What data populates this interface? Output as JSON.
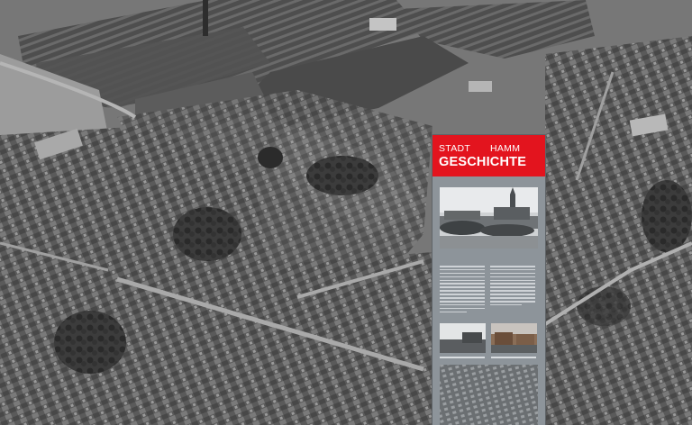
{
  "scene": {
    "description_tag": "aerial-photo"
  },
  "board": {
    "header_left": "STADT",
    "header_right": "HAMM",
    "title": "GESCHICHTE",
    "colors": {
      "red": "#e3141e",
      "panel": "#8d949a"
    }
  }
}
